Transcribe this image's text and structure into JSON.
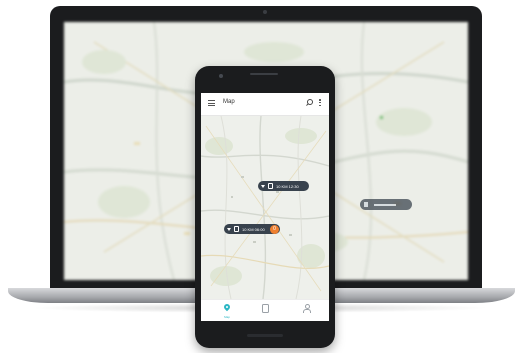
{
  "phone": {
    "app_bar": {
      "title": "Map",
      "menu_icon": "hamburger-menu-icon",
      "search_icon": "search-icon",
      "overflow_icon": "more-vert-icon"
    },
    "markers": [
      {
        "icons": [
          "filter-icon",
          "train-icon"
        ],
        "label": "10 KM 12:30"
      },
      {
        "icons": [
          "filter-icon",
          "train-icon"
        ],
        "label": "10 KM 06:00",
        "badge": "0",
        "badge_color": "#ee7f2f"
      }
    ],
    "bottom_nav": [
      {
        "icon": "map-pin-icon",
        "label": "Map",
        "active": true
      },
      {
        "icon": "train-icon",
        "label": "",
        "active": false
      },
      {
        "icon": "user-icon",
        "label": "",
        "active": false
      }
    ],
    "accent_color": "#2cb7c4",
    "marker_color": "#38424d"
  },
  "laptop": {
    "screen_content": "blurred map",
    "marker_color": "#3d4650"
  }
}
